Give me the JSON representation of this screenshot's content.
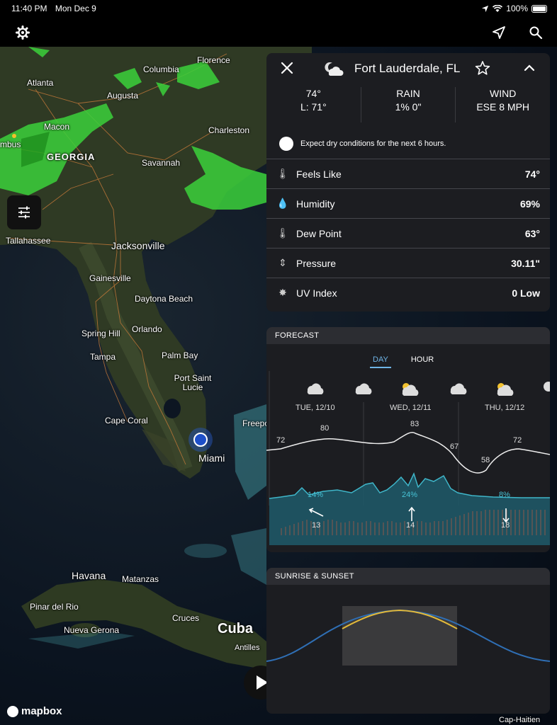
{
  "status": {
    "time": "11:40 PM",
    "date": "Mon Dec 9",
    "battery": "100%"
  },
  "map": {
    "cities": [
      "Florence",
      "Columbia",
      "Atlanta",
      "Augusta",
      "Macon",
      "GEORGIA",
      "Charleston",
      "Savannah",
      "mbus",
      "Tallahassee",
      "Jacksonville",
      "Gainesville",
      "Daytona Beach",
      "Spring Hill",
      "Orlando",
      "Tampa",
      "Palm Bay",
      "Port Saint Lucie",
      "Cape Coral",
      "Freepo",
      "Miami",
      "Havana",
      "Matanzas",
      "Pinar del Rio",
      "Nueva Gerona",
      "Cruces",
      "Cuba",
      "Antilles",
      "Cap-Haitien"
    ],
    "attribution": "mapbox"
  },
  "current": {
    "location": "Fort Lauderdale, FL",
    "temp": "74°",
    "low": "L: 71°",
    "rain_label": "RAIN",
    "rain_value": "1% 0\"",
    "wind_label": "WIND",
    "wind_value": "ESE 8 MPH",
    "expect": "Expect dry conditions for the next 6 hours.",
    "rows": [
      {
        "label": "Feels Like",
        "value": "74°",
        "icon": "thermometer-icon"
      },
      {
        "label": "Humidity",
        "value": "69%",
        "icon": "droplet-icon"
      },
      {
        "label": "Dew Point",
        "value": "63°",
        "icon": "thermometer-icon"
      },
      {
        "label": "Pressure",
        "value": "30.11\"",
        "icon": "pressure-icon"
      },
      {
        "label": "UV Index",
        "value": "0 Low",
        "icon": "sun-icon"
      }
    ]
  },
  "forecast": {
    "title": "FORECAST",
    "tabs": [
      "DAY",
      "HOUR"
    ],
    "days": [
      "TUE, 12/10",
      "WED, 12/11",
      "THU, 12/12"
    ],
    "temps": [
      "72",
      "80",
      "83",
      "67",
      "58",
      "72"
    ],
    "precip": [
      "14%",
      "24%",
      "8%"
    ],
    "wind": [
      "13",
      "14",
      "18"
    ]
  },
  "sun": {
    "title": "SUNRISE & SUNSET"
  }
}
